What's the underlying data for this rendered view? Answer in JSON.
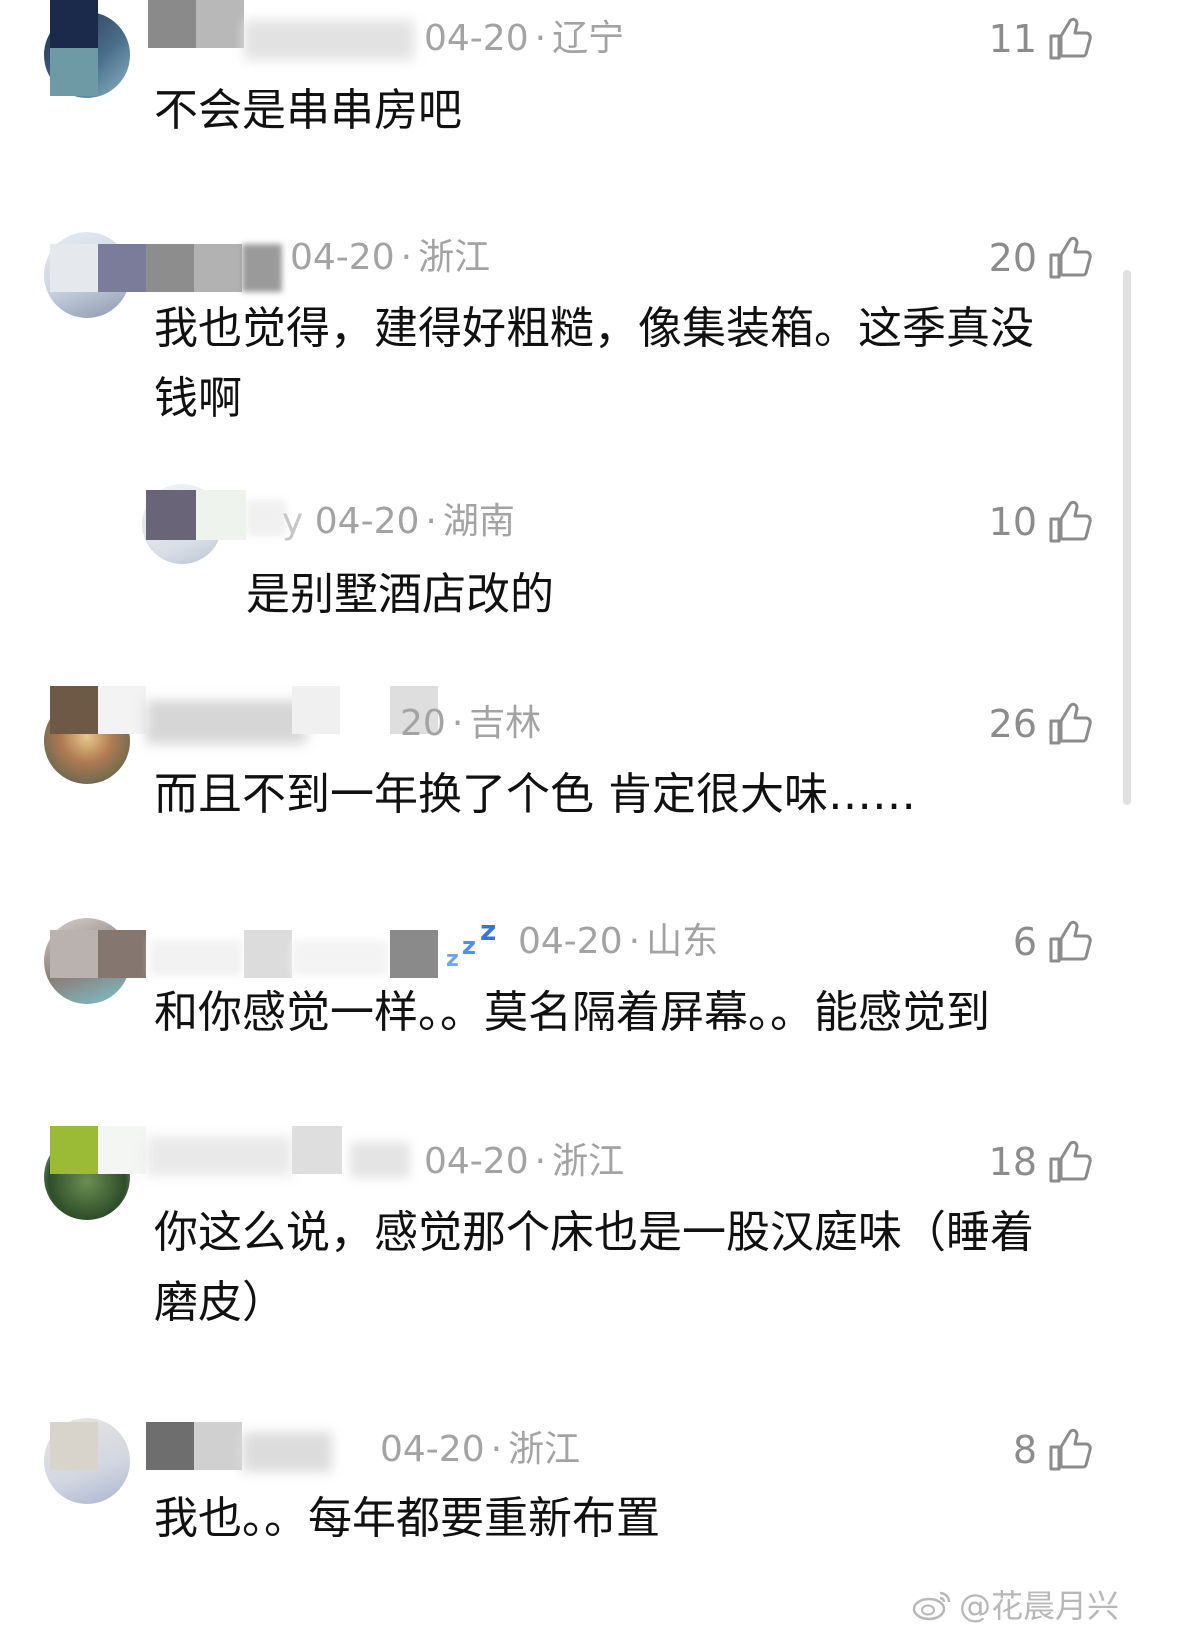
{
  "comments": [
    {
      "name_fragment": "",
      "date": "04-20",
      "region": "辽宁",
      "likes": "11",
      "text": "不会是串串房吧"
    },
    {
      "name_fragment": "",
      "date": "04-20",
      "region": "浙江",
      "likes": "20",
      "text": "我也觉得，建得好粗糙，像集装箱。这季真没\n钱啊"
    },
    {
      "name_fragment": "y",
      "date": "04-20",
      "region": "湖南",
      "likes": "10",
      "text": "是别墅酒店改的"
    },
    {
      "name_fragment": "",
      "date": "20",
      "region": "吉林",
      "likes": "26",
      "text": "而且不到一年换了个色 肯定很大味……"
    },
    {
      "name_fragment": "",
      "date": "04-20",
      "region": "山东",
      "likes": "6",
      "text": "和你感觉一样。。莫名隔着屏幕。。能感觉到"
    },
    {
      "name_fragment": "",
      "date": "04-20",
      "region": "浙江",
      "likes": "18",
      "text": "你这么说，感觉那个床也是一股汉庭味（睡着\n磨皮）"
    },
    {
      "name_fragment": "",
      "date": "04-20",
      "region": "浙江",
      "likes": "8",
      "text": "我也。。每年都要重新布置"
    }
  ],
  "watermark": "@花晨月兴",
  "colors": {
    "meta": "#a3a3a3",
    "like": "#8c8c8c",
    "text": "#111111"
  },
  "icons": {
    "like": "thumbs-up-icon",
    "watermark": "weibo-logo-icon"
  }
}
